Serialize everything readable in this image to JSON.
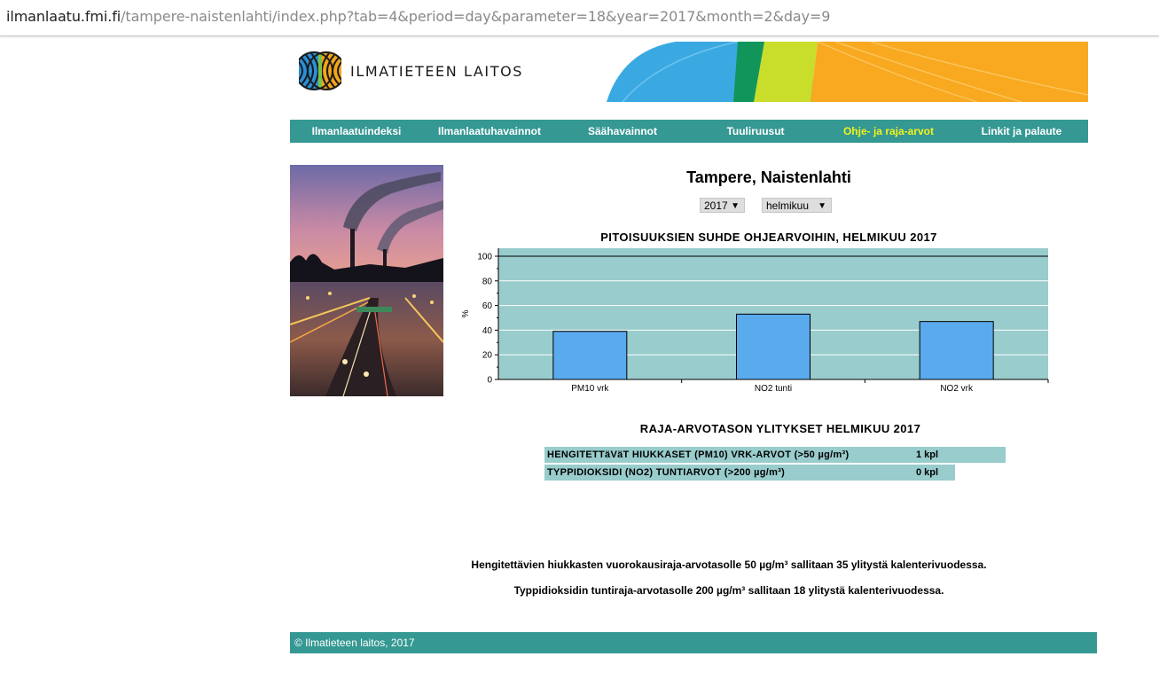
{
  "browser": {
    "url_domain": "ilmanlaatu.fmi.fi",
    "url_path": "/tampere-naistenlahti/index.php?tab=4&period=day&parameter=18&year=2017&month=2&day=9"
  },
  "header": {
    "logo_text": "ILMATIETEEN LAITOS"
  },
  "nav": {
    "items": [
      {
        "label": "Ilmanlaatuindeksi",
        "active": false
      },
      {
        "label": "Ilmanlaatuhavainnot",
        "active": false
      },
      {
        "label": "Säähavainnot",
        "active": false
      },
      {
        "label": "Tuuliruusut",
        "active": false
      },
      {
        "label": "Ohje- ja raja-arvot",
        "active": true
      },
      {
        "label": "Linkit ja palaute",
        "active": false
      }
    ],
    "active_color": "#f2f21b",
    "bar_color": "#359893"
  },
  "main": {
    "title": "Tampere, Naistenlahti",
    "year_select": "2017",
    "month_select": "helmikuu",
    "chart_title": "PITOISUUKSIEN SUHDE OHJEARVOIHIN, HELMIKUU 2017",
    "exceed_title": "RAJA-ARVOTASON YLITYKSET HELMIKUU 2017",
    "exceed_rows": [
      {
        "label": "HENGITETTäVäT HIUKKASET (PM10) VRK-ARVOT (>50 µg/m³)",
        "count": "1 kpl"
      },
      {
        "label": "TYPPIDIOKSIDI (NO2) TUNTIARVOT (>200 µg/m³)",
        "count": "0 kpl"
      }
    ],
    "notes": [
      "Hengitettävien hiukkasten vuorokausiraja-arvotasolle 50 µg/m³ sallitaan 35 ylitystä kalenterivuodessa.",
      "Typpidioksidin tuntiraja-arvotasolle 200 µg/m³ sallitaan 18 ylitystä kalenterivuodessa."
    ]
  },
  "chart_data": {
    "type": "bar",
    "title": "PITOISUUKSIEN SUHDE OHJEARVOIHIN, HELMIKUU 2017",
    "categories": [
      "PM10 vrk",
      "NO2 tunti",
      "NO2 vrk"
    ],
    "values": [
      39,
      53,
      47
    ],
    "xlabel": "",
    "ylabel": "%",
    "ylim": [
      0,
      100
    ],
    "yticks": [
      0,
      20,
      40,
      60,
      80,
      100
    ],
    "grid": true,
    "background_color": "#99cccc",
    "bar_color": "#5aaaee"
  },
  "footer": {
    "text": "© Ilmatieteen laitos, 2017"
  }
}
